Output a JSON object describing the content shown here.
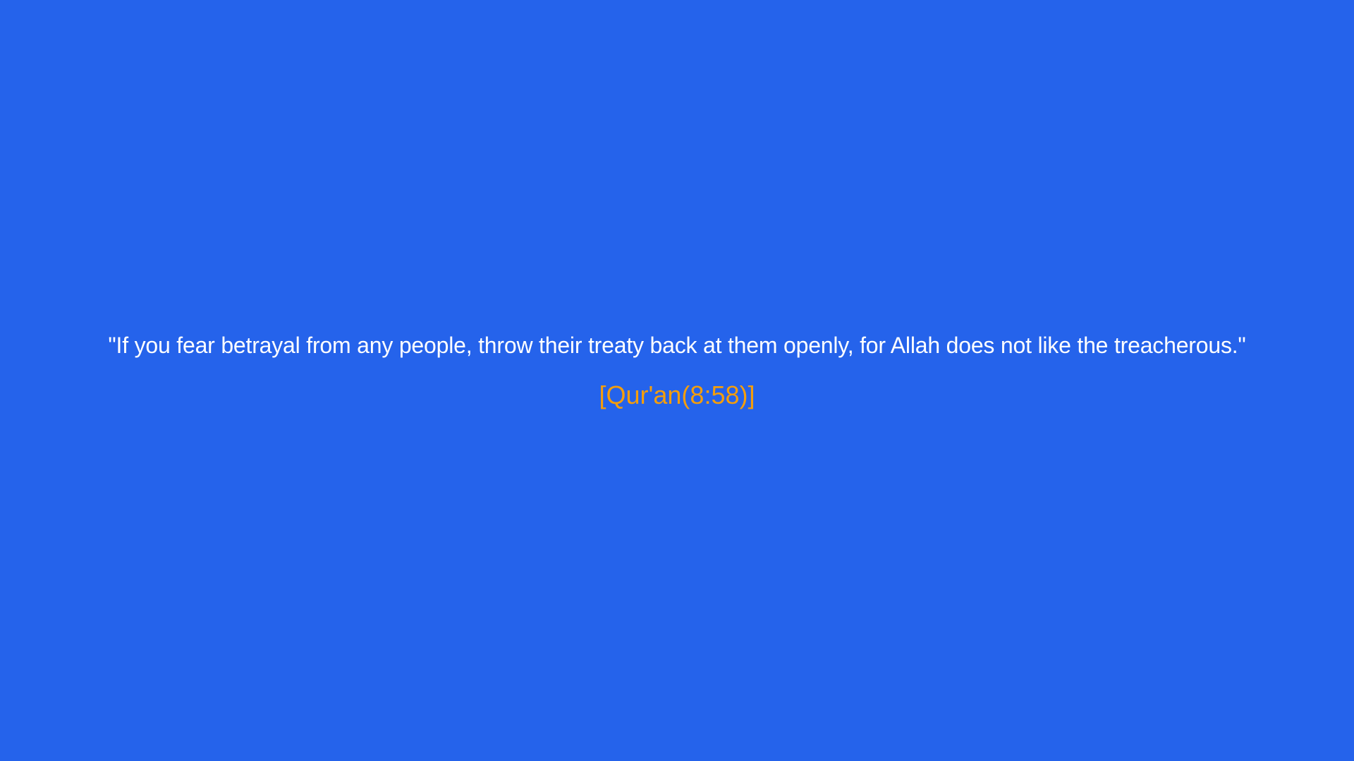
{
  "quote": {
    "text": "\"If you fear betrayal from any people, throw their treaty back at them openly, for Allah does not like the treacherous.\"",
    "citation": "[Qur'an(8:58)]"
  },
  "colors": {
    "background": "#2563eb",
    "quote_text": "#ffffff",
    "citation_text": "#f59e0b"
  }
}
